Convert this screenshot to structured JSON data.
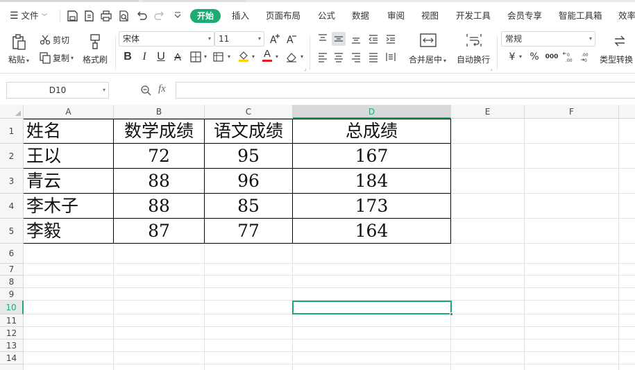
{
  "menu": {
    "file_label": "文件",
    "tabs": [
      "开始",
      "插入",
      "页面布局",
      "公式",
      "数据",
      "审阅",
      "视图",
      "开发工具",
      "会员专享",
      "智能工具箱",
      "效率"
    ],
    "active_tab": "开始"
  },
  "ribbon": {
    "paste_label": "粘贴",
    "cut_label": "剪切",
    "copy_label": "复制",
    "format_painter_label": "格式刷",
    "font_name": "宋体",
    "font_size": "11",
    "bold": "B",
    "italic": "I",
    "underline": "U",
    "strike": "A",
    "font_color_letter": "A",
    "merge_center_label": "合并居中",
    "wrap_text_label": "自动换行",
    "number_format": "常规",
    "currency_symbol": "¥",
    "percent_symbol": "%",
    "thousands_symbol": "000",
    "type_convert_label": "类型转换",
    "colors": {
      "accent": "#1eab72",
      "font_color_bar": "#e02020",
      "fill_color_bar": "#ffd200"
    }
  },
  "formula_bar": {
    "name_box": "D10",
    "fx_label": "fx",
    "formula": ""
  },
  "sheet": {
    "columns": [
      "A",
      "B",
      "C",
      "D",
      "E",
      "F"
    ],
    "active_column": "D",
    "rows": [
      "1",
      "2",
      "3",
      "4",
      "5",
      "6",
      "7",
      "8",
      "9",
      "10",
      "11",
      "12",
      "13",
      "14"
    ],
    "active_row": "10",
    "table": {
      "header": [
        "姓名",
        "数学成绩",
        "语文成绩",
        "总成绩"
      ],
      "rows": [
        [
          "王以",
          "72",
          "95",
          "167"
        ],
        [
          "青云",
          "88",
          "96",
          "184"
        ],
        [
          "李木子",
          "88",
          "85",
          "173"
        ],
        [
          "李毅",
          "87",
          "77",
          "164"
        ]
      ]
    }
  }
}
